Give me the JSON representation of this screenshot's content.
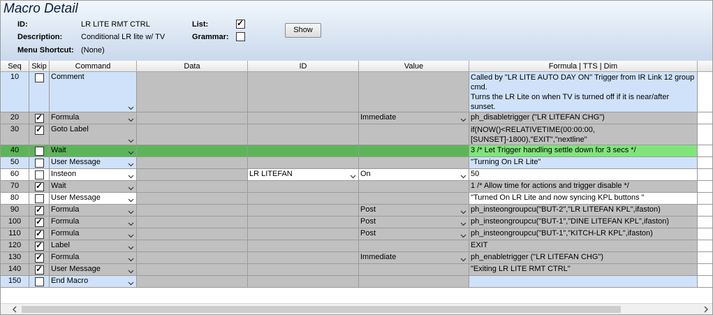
{
  "window": {
    "title": "Macro Detail"
  },
  "details": {
    "id_label": "ID:",
    "id_value": "LR LITE RMT CTRL",
    "description_label": "Description:",
    "description_value": "Conditional LR lite w/ TV",
    "shortcut_label": "Menu Shortcut:",
    "shortcut_value": "(None)",
    "list_label": "List:",
    "list_checked": true,
    "grammar_label": "Grammar:",
    "grammar_checked": false,
    "show_button": "Show"
  },
  "columns": [
    "Seq",
    "Skip",
    "Command",
    "Data",
    "ID",
    "Value",
    "Formula | TTS | Dim"
  ],
  "rows": [
    {
      "seq": "10",
      "skip": false,
      "command": "Comment",
      "data": "",
      "id": "",
      "value": "",
      "formula": "Called by \"LR LITE AUTO DAY ON\" Trigger from IR Link 12 group cmd.\nTurns the LR Lite on when TV is turned off if it is near/after sunset.",
      "style": "blue"
    },
    {
      "seq": "20",
      "skip": true,
      "command": "Formula",
      "data": "",
      "id": "",
      "value": "Immediate",
      "formula": "ph_disabletrigger (\"LR LITEFAN CHG\")",
      "style": "gray"
    },
    {
      "seq": "30",
      "skip": true,
      "command": "Goto Label",
      "data": "",
      "id": "",
      "value": "",
      "formula": "if(NOW()<RELATIVETIME(00:00:00,[SUNSET]-1800),\"EXIT\",\"nextline\"\n)",
      "style": "gray"
    },
    {
      "seq": "40",
      "skip": false,
      "command": "Wait",
      "data": "",
      "id": "",
      "value": "",
      "formula": "3  /* Let Trigger handling settle down for 3 secs  */",
      "style": "green"
    },
    {
      "seq": "50",
      "skip": false,
      "command": "User Message",
      "data": "",
      "id": "",
      "value": "",
      "formula": "\"Turning On LR Lite\"",
      "style": "blue"
    },
    {
      "seq": "60",
      "skip": false,
      "command": "Insteon",
      "data": "",
      "id": "LR LITEFAN",
      "value": "On",
      "formula": "50",
      "style": "white"
    },
    {
      "seq": "70",
      "skip": true,
      "command": "Wait",
      "data": "",
      "id": "",
      "value": "",
      "formula": "1    /*  Allow time for actions and trigger disable */",
      "style": "gray"
    },
    {
      "seq": "80",
      "skip": false,
      "command": "User Message",
      "data": "",
      "id": "",
      "value": "",
      "formula": "\"Turned On LR Lite and now syncing KPL buttons \"",
      "style": "white"
    },
    {
      "seq": "90",
      "skip": true,
      "command": "Formula",
      "data": "",
      "id": "",
      "value": "Post",
      "formula": "ph_insteongroupcu(\"BUT-2\",\"LR LITEFAN KPL\",ifaston)",
      "style": "gray"
    },
    {
      "seq": "100",
      "skip": true,
      "command": "Formula",
      "data": "",
      "id": "",
      "value": "Post",
      "formula": "ph_insteongroupcu(\"BUT-1\",\"DINE LITEFAN KPL\",ifaston)",
      "style": "gray"
    },
    {
      "seq": "110",
      "skip": true,
      "command": "Formula",
      "data": "",
      "id": "",
      "value": "Post",
      "formula": "ph_insteongroupcu(\"BUT-1\",\"KITCH-LR KPL\",ifaston)",
      "style": "gray"
    },
    {
      "seq": "120",
      "skip": true,
      "command": "Label",
      "data": "",
      "id": "",
      "value": "",
      "formula": "EXIT",
      "style": "gray"
    },
    {
      "seq": "130",
      "skip": true,
      "command": "Formula",
      "data": "",
      "id": "",
      "value": "Immediate",
      "formula": "ph_enabletrigger (\"LR LITEFAN CHG\")",
      "style": "gray"
    },
    {
      "seq": "140",
      "skip": true,
      "command": "User Message",
      "data": "",
      "id": "",
      "value": "",
      "formula": "\"Exiting LR LITE RMT CTRL\"",
      "style": "gray"
    },
    {
      "seq": "150",
      "skip": false,
      "command": "End Macro",
      "data": "",
      "id": "",
      "value": "",
      "formula": "",
      "style": "blue"
    }
  ]
}
